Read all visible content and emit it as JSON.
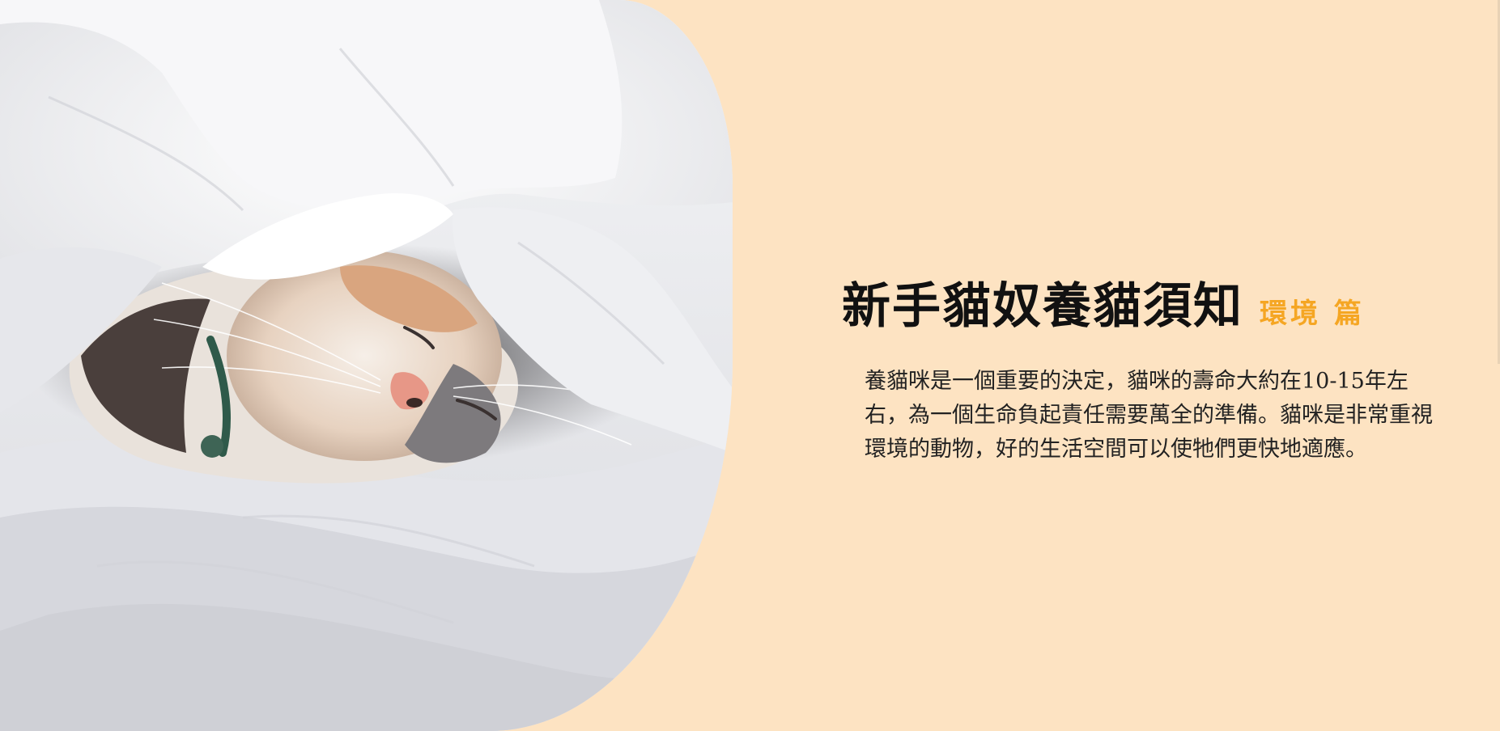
{
  "hero": {
    "image_description": "cat-sleeping-under-white-duvet"
  },
  "heading": {
    "title": "新手貓奴養貓須知",
    "subtitle": "環境 篇"
  },
  "body": {
    "description": "養貓咪是一個重要的決定，貓咪的壽命大約在10-15年左右，為一個生命負起責任需要萬全的準備。貓咪是非常重視環境的動物，好的生活空間可以使牠們更快地適應。"
  },
  "colors": {
    "background": "#fde3c2",
    "accent": "#f5a623",
    "title": "#111111"
  }
}
